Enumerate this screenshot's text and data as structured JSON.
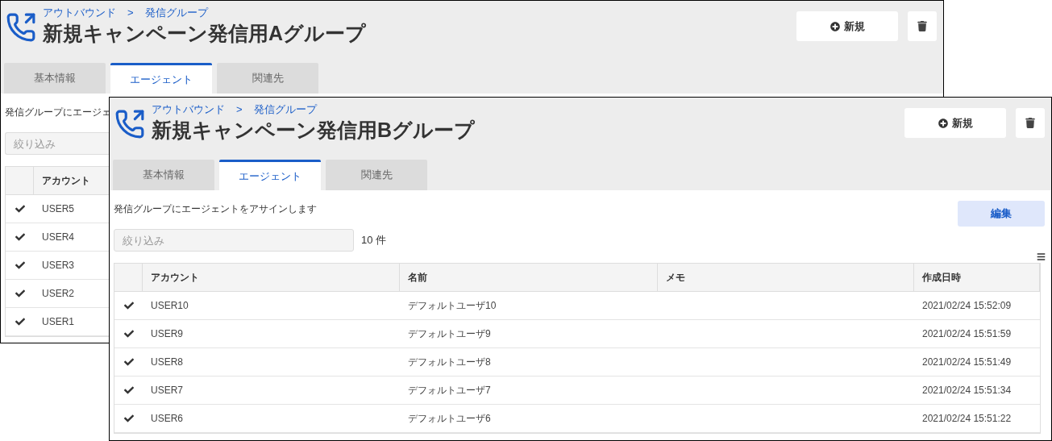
{
  "windows": [
    {
      "breadcrumb": [
        "アウトバウンド",
        "発信グループ"
      ],
      "breadcrumb_separator": ">",
      "title": "新規キャンペーン発信用Aグループ",
      "new_button": "新規",
      "tabs": [
        {
          "label": "基本情報",
          "selected": false
        },
        {
          "label": "エージェント",
          "selected": true
        },
        {
          "label": "関連先",
          "selected": false
        }
      ],
      "description": "発信グループにエージェ",
      "filter": {
        "placeholder": "絞り込み"
      },
      "table": {
        "columns": [
          "アカウント"
        ],
        "rows": [
          {
            "checked": true,
            "cells": [
              "USER5"
            ]
          },
          {
            "checked": true,
            "cells": [
              "USER4"
            ]
          },
          {
            "checked": true,
            "cells": [
              "USER3"
            ]
          },
          {
            "checked": true,
            "cells": [
              "USER2"
            ]
          },
          {
            "checked": true,
            "cells": [
              "USER1"
            ]
          }
        ]
      }
    },
    {
      "breadcrumb": [
        "アウトバウンド",
        "発信グループ"
      ],
      "breadcrumb_separator": ">",
      "title": "新規キャンペーン発信用Bグループ",
      "new_button": "新規",
      "tabs": [
        {
          "label": "基本情報",
          "selected": false
        },
        {
          "label": "エージェント",
          "selected": true
        },
        {
          "label": "関連先",
          "selected": false
        }
      ],
      "description": "発信グループにエージェントをアサインします",
      "edit_button": "編集",
      "filter": {
        "placeholder": "絞り込み"
      },
      "count": "10 件",
      "table": {
        "columns": [
          "アカウント",
          "名前",
          "メモ",
          "作成日時"
        ],
        "rows": [
          {
            "checked": true,
            "cells": [
              "USER10",
              "デフォルトユーザ10",
              "",
              "2021/02/24 15:52:09"
            ]
          },
          {
            "checked": true,
            "cells": [
              "USER9",
              "デフォルトユーザ9",
              "",
              "2021/02/24 15:51:59"
            ]
          },
          {
            "checked": true,
            "cells": [
              "USER8",
              "デフォルトユーザ8",
              "",
              "2021/02/24 15:51:49"
            ]
          },
          {
            "checked": true,
            "cells": [
              "USER7",
              "デフォルトユーザ7",
              "",
              "2021/02/24 15:51:34"
            ]
          },
          {
            "checked": true,
            "cells": [
              "USER6",
              "デフォルトユーザ6",
              "",
              "2021/02/24 15:51:22"
            ]
          }
        ]
      }
    }
  ]
}
